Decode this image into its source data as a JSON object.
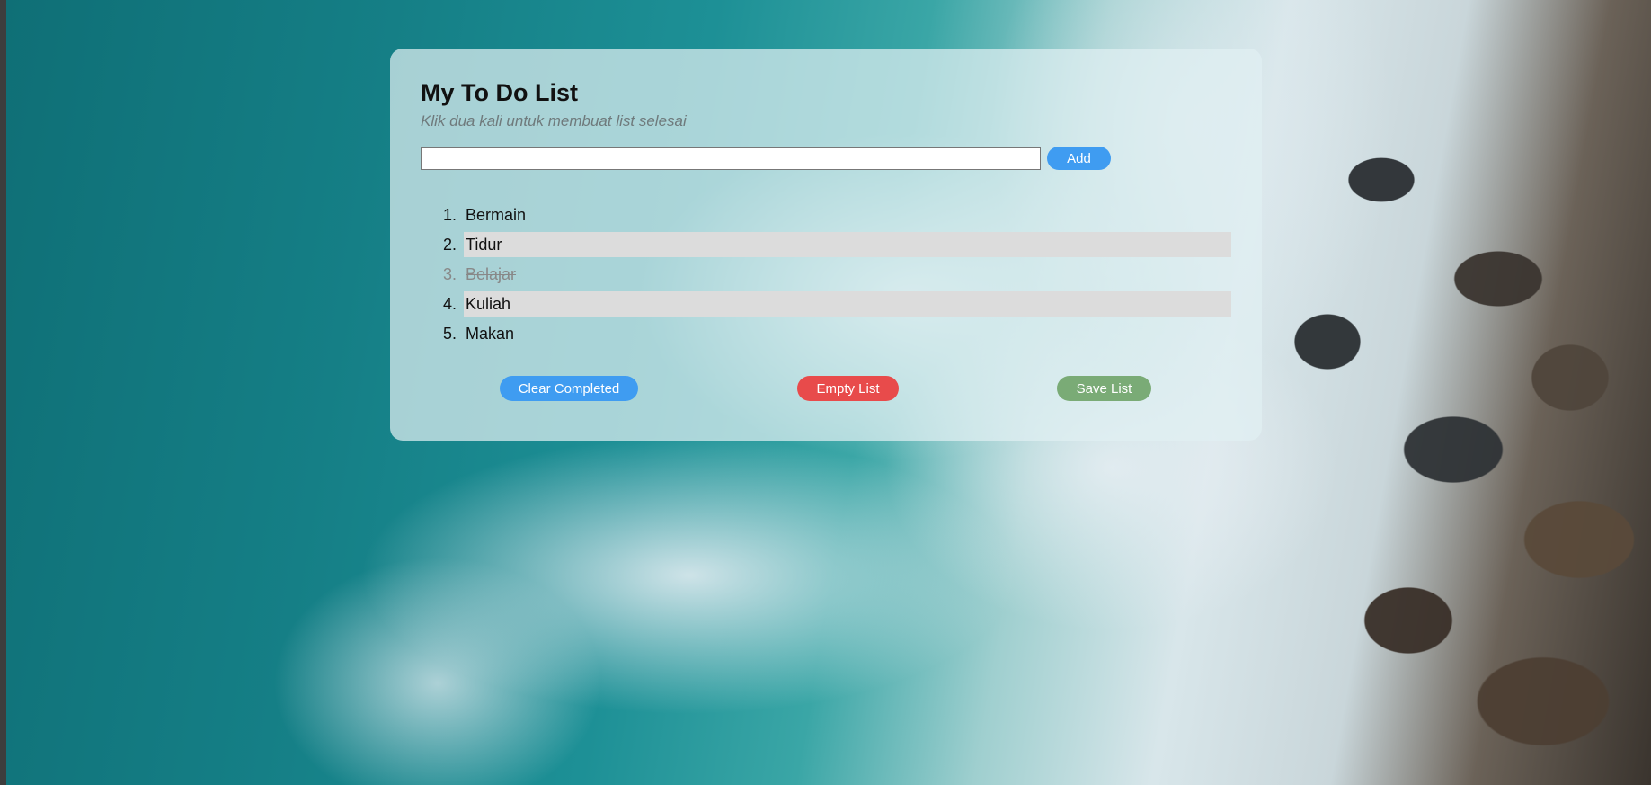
{
  "app": {
    "title": "My To Do List",
    "subtitle": "Klik dua kali untuk membuat list selesai"
  },
  "input": {
    "value": "",
    "add_label": "Add"
  },
  "todos": [
    {
      "number": "1.",
      "text": "Bermain",
      "completed": false,
      "highlighted": false
    },
    {
      "number": "2.",
      "text": "Tidur",
      "completed": false,
      "highlighted": true
    },
    {
      "number": "3.",
      "text": "Belajar",
      "completed": true,
      "highlighted": false
    },
    {
      "number": "4.",
      "text": "Kuliah",
      "completed": false,
      "highlighted": true
    },
    {
      "number": "5.",
      "text": "Makan",
      "completed": false,
      "highlighted": false
    }
  ],
  "actions": {
    "clear_completed_label": "Clear Completed",
    "empty_list_label": "Empty List",
    "save_list_label": "Save List"
  },
  "colors": {
    "primary": "#3f9cf1",
    "danger": "#e84b4b",
    "success": "#7aab76",
    "highlight_row": "#dcdcdc"
  }
}
